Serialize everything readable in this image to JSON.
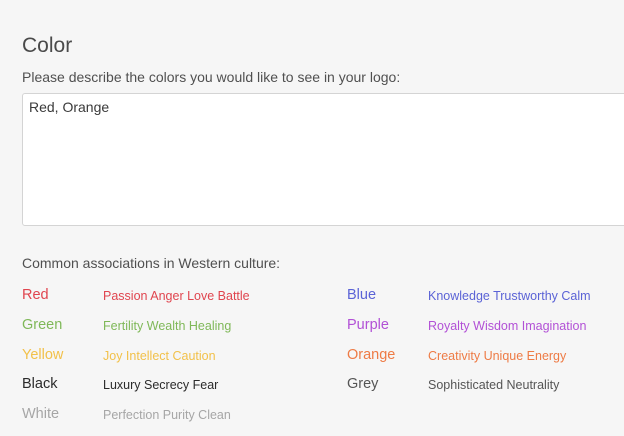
{
  "section": {
    "title": "Color",
    "prompt": "Please describe the colors you would like to see in your logo:",
    "answer": "Red, Orange"
  },
  "associations": {
    "heading": "Common associations in Western culture:",
    "left": [
      {
        "name": "Red",
        "meaning": "Passion Anger Love Battle",
        "color": "#e0454f"
      },
      {
        "name": "Green",
        "meaning": "Fertility Wealth Healing",
        "color": "#7fb858"
      },
      {
        "name": "Yellow",
        "meaning": "Joy Intellect Caution",
        "color": "#f2c14a"
      },
      {
        "name": "Black",
        "meaning": "Luxury Secrecy Fear",
        "color": "#2b2b2b"
      },
      {
        "name": "White",
        "meaning": "Perfection Purity Clean",
        "color": "#a6a6a6"
      }
    ],
    "right": [
      {
        "name": "Blue",
        "meaning": "Knowledge Trustworthy Calm",
        "color": "#5b63d6"
      },
      {
        "name": "Purple",
        "meaning": "Royalty Wisdom Imagination",
        "color": "#b251d6"
      },
      {
        "name": "Orange",
        "meaning": "Creativity Unique Energy",
        "color": "#ee7b45"
      },
      {
        "name": "Grey",
        "meaning": "Sophisticated Neutrality",
        "color": "#555555"
      }
    ]
  }
}
